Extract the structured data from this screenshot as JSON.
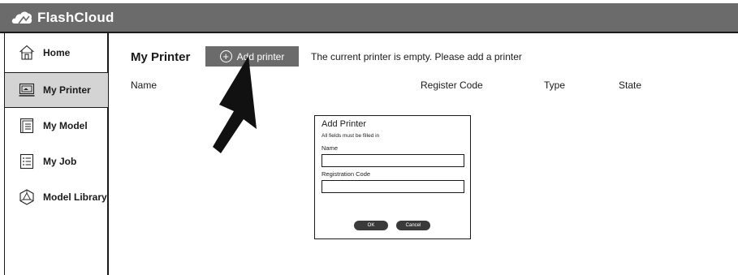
{
  "app": {
    "title": "FlashCloud"
  },
  "sidebar": {
    "items": [
      {
        "label": "Home",
        "icon": "home-icon",
        "active": false
      },
      {
        "label": "My Printer",
        "icon": "printer-icon",
        "active": true
      },
      {
        "label": "My Model",
        "icon": "document-icon",
        "active": false
      },
      {
        "label": "My Job",
        "icon": "list-icon",
        "active": false
      },
      {
        "label": "Model Library",
        "icon": "model-library-icon",
        "active": false
      }
    ]
  },
  "main": {
    "title": "My Printer",
    "add_button_label": "Add printer",
    "empty_message": "The current printer is empty. Please add a printer",
    "columns": [
      "Name",
      "Register Code",
      "Type",
      "State"
    ]
  },
  "dialog": {
    "title": "Add Printer",
    "subtitle": "All fields must be filled in",
    "name_label": "Name",
    "name_value": "",
    "code_label": "Registration Code",
    "code_value": "",
    "ok_label": "OK",
    "cancel_label": "Cancel"
  },
  "colors": {
    "topbar": "#6b6b6b",
    "active_nav": "#d4d4d4",
    "button": "#6b6b6b",
    "dialog_button": "#3a3a3a"
  }
}
